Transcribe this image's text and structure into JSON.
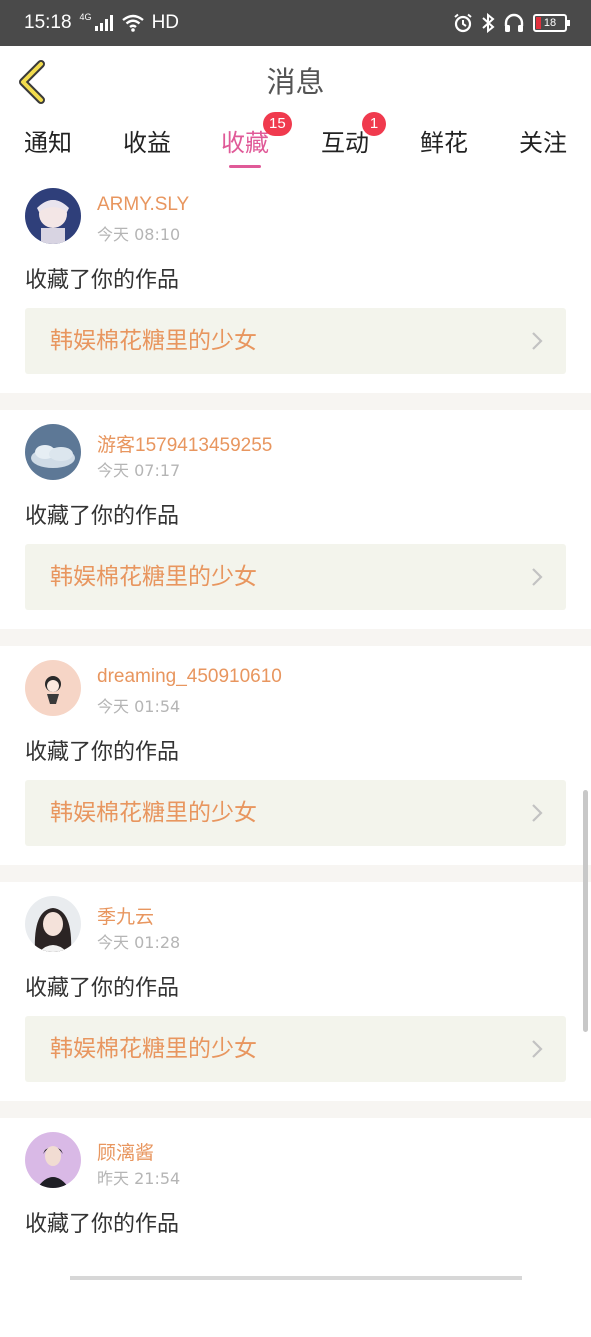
{
  "status_bar": {
    "time": "15:18",
    "network": "4G",
    "hd_label": "HD",
    "battery": "18",
    "icons": [
      "signal-icon",
      "wifi-icon",
      "alarm-icon",
      "bluetooth-icon",
      "headphones-icon",
      "battery-icon"
    ]
  },
  "header": {
    "title": "消息",
    "back_icon": "chevron-left-icon"
  },
  "tabs": [
    {
      "label": "通知",
      "badge": ""
    },
    {
      "label": "收益",
      "badge": ""
    },
    {
      "label": "收藏",
      "badge": "15",
      "active": true
    },
    {
      "label": "互动",
      "badge": "1"
    },
    {
      "label": "鲜花",
      "badge": ""
    },
    {
      "label": "关注",
      "badge": ""
    }
  ],
  "messages": [
    {
      "username": "ARMY.SLY",
      "time": "今天 08:10",
      "action": "收藏了你的作品",
      "work_title": "韩娱棉花糖里的少女"
    },
    {
      "username": "游客1579413459255",
      "time": "今天 07:17",
      "action": "收藏了你的作品",
      "work_title": "韩娱棉花糖里的少女"
    },
    {
      "username": "dreaming_450910610",
      "time": "今天 01:54",
      "action": "收藏了你的作品",
      "work_title": "韩娱棉花糖里的少女"
    },
    {
      "username": "季九云",
      "time": "今天 01:28",
      "action": "收藏了你的作品",
      "work_title": "韩娱棉花糖里的少女"
    },
    {
      "username": "顾漓酱",
      "time": "昨天 21:54",
      "action": "收藏了你的作品",
      "work_title": ""
    }
  ],
  "colors": {
    "accent": "#e05a98",
    "username": "#e8965f",
    "badge": "#f03a4e",
    "card_bg": "#f3f4ec",
    "status_bar": "#4a4a4a"
  }
}
